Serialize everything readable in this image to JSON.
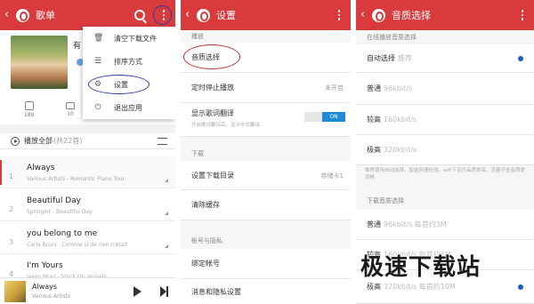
{
  "panel1": {
    "title": "歌单",
    "truncated_text": "有",
    "stats": [
      {
        "value": "189"
      },
      {
        "value": "10"
      }
    ],
    "play_all": "播放全部",
    "play_all_count": "(共22首)",
    "songs": [
      {
        "num": "1",
        "title": "Always",
        "sub": "Various Artists - Romantic Piano Tour"
      },
      {
        "num": "2",
        "title": "Beautiful Day",
        "sub": "Springlot - Beautiful Day"
      },
      {
        "num": "3",
        "title": "you belong to me",
        "sub": "Carla Bruni - Comme si de rien n'était"
      },
      {
        "num": "4",
        "title": "I'm Yours",
        "sub": "Jason Mraz - Stuck On Vessels"
      }
    ],
    "menu": [
      {
        "icon": "trash-icon",
        "label": "清空下载文件"
      },
      {
        "icon": "sort-icon",
        "label": "排序方式"
      },
      {
        "icon": "gear-icon",
        "label": "设置"
      },
      {
        "icon": "exit-icon",
        "label": "退出应用"
      }
    ],
    "player": {
      "title": "Always",
      "artist": "Various Artists"
    }
  },
  "panel2": {
    "title": "设置",
    "sections": {
      "play": "播放",
      "download": "下载",
      "account": "帐号与隐私"
    },
    "rows": {
      "quality": "音质选择",
      "timer": "定时停止播放",
      "timer_value": "未开启",
      "lyrics": "显示歌词翻译",
      "lyrics_hint": "开启歌词翻译后，显示中文翻译",
      "toggle": "ON",
      "dir": "设置下载目录",
      "dir_value": "存储卡1",
      "clear": "清除缓存",
      "bind": "绑定帐号",
      "msg": "消息和隐私设置"
    }
  },
  "panel3": {
    "title": "音质选择",
    "online_section": "在线播放音质选择",
    "options": [
      {
        "label": "自动选择",
        "hint": "推荐",
        "selected": true
      },
      {
        "label": "普通",
        "hint": "96kbit/s",
        "selected": false
      },
      {
        "label": "较高",
        "hint": "160kbit/s",
        "selected": false
      },
      {
        "label": "极高",
        "hint": "320kbit/s",
        "selected": false
      }
    ],
    "note": "推荐使用自动选择，智能网速检测，wifi下音乐品质更高，流量节省音质更流畅",
    "download_section": "下载音质选择",
    "dl_options": [
      {
        "label": "普通",
        "hint": "96kbit/s 每首约3M"
      },
      {
        "label": "较高",
        "hint": "160kbit/s 每首约5M"
      },
      {
        "label": "极高",
        "hint": "320kbit/s 每首约10M"
      }
    ]
  },
  "watermark": "极速下载站",
  "colors": {
    "brand": "#d93a3c",
    "toggle": "#1f8ad6",
    "radio": "#1b5ec2"
  }
}
